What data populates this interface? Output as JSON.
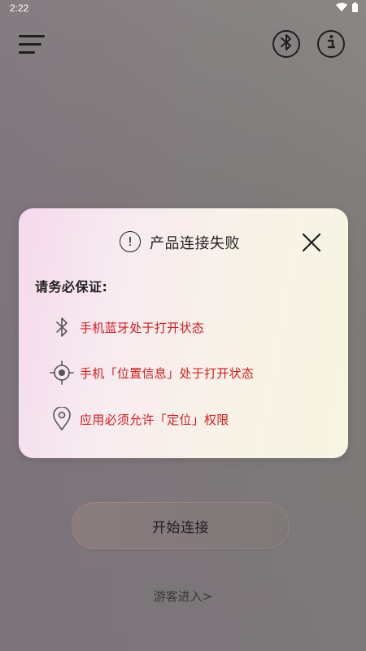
{
  "status_bar": {
    "time": "2:22",
    "icons": [
      "wifi-icon",
      "battery-icon"
    ]
  },
  "top_bar": {
    "icons": [
      "menu-icon",
      "bluetooth-icon",
      "info-icon"
    ]
  },
  "dialog": {
    "title": "产品连接失败",
    "subtitle": "请务必保证:",
    "items": [
      {
        "icon": "bluetooth-icon",
        "text": "手机蓝牙处于打开状态"
      },
      {
        "icon": "location-target-icon",
        "text": "手机「位置信息」处于打开状态"
      },
      {
        "icon": "map-pin-icon",
        "text": "应用必须允许「定位」权限"
      }
    ]
  },
  "actions": {
    "connect_label": "开始连接",
    "guest_label": "游客进入>"
  },
  "colors": {
    "requirement_text": "#d81b1b",
    "dialog_bg_start": "#f6d9ee",
    "dialog_bg_end": "#f8f5e3"
  }
}
